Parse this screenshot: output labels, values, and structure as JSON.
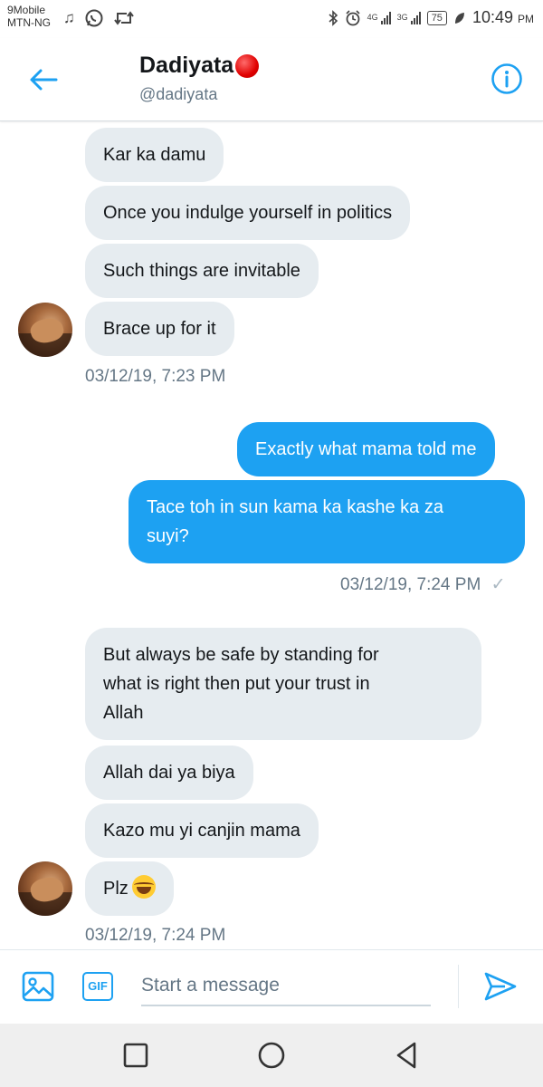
{
  "status_bar": {
    "carrier_line1": "9Mobile",
    "carrier_line2": "MTN-NG",
    "sig1_label": "4G",
    "sig2_label": "3G",
    "battery": "75",
    "time": "10:49",
    "time_suffix": "PM"
  },
  "header": {
    "name": "Dadiyata",
    "handle": "@dadiyata"
  },
  "messages": [
    {
      "text": "Kar ka damu"
    },
    {
      "text": "Once you indulge yourself in politics"
    },
    {
      "text": "Such things are invitable"
    },
    {
      "text": "Brace up for it"
    },
    {
      "timestamp": "03/12/19, 7:23 PM"
    },
    {
      "text": "Exactly what mama told me"
    },
    {
      "text_line1": "Tace toh in sun kama ka kashe ka za",
      "text_line2": "suyi?"
    },
    {
      "timestamp": "03/12/19, 7:24 PM",
      "read_mark": "✓"
    },
    {
      "text_line1": "But always be safe by standing for",
      "text_line2": "what is right then put your trust in",
      "text_line3": "Allah"
    },
    {
      "text": "Allah dai ya biya"
    },
    {
      "text": "Kazo mu yi canjin mama"
    },
    {
      "text": "Plz"
    },
    {
      "timestamp": "03/12/19, 7:24 PM"
    }
  ],
  "compose": {
    "gif_label": "GIF",
    "placeholder": "Start a message"
  },
  "colors": {
    "accent": "#1da1f2",
    "incoming_bubble": "#e6ecf0",
    "muted_text": "#657786"
  },
  "icons": {
    "back": "arrow-left-icon",
    "info": "info-icon",
    "image": "image-icon",
    "send": "send-icon",
    "nav_recent": "square-icon",
    "nav_home": "circle-icon",
    "nav_back": "triangle-back-icon"
  }
}
